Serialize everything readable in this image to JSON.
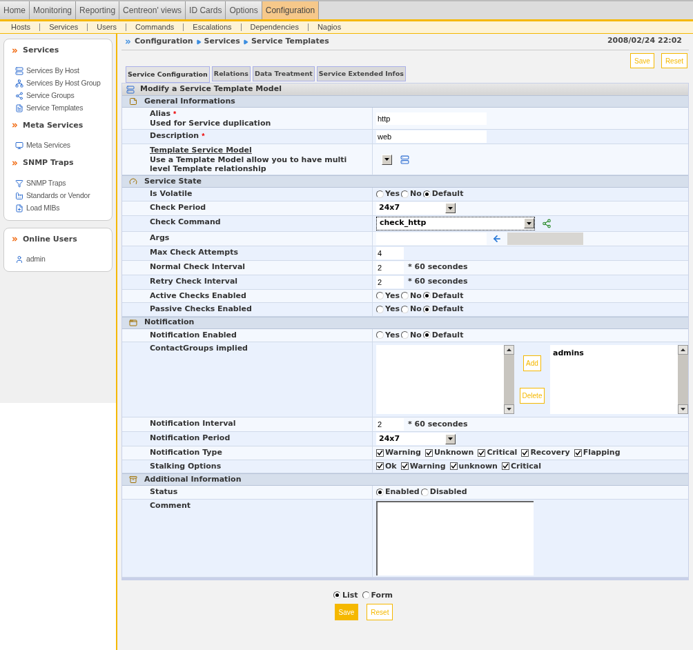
{
  "top_tabs": [
    {
      "label": "Home",
      "selected": false
    },
    {
      "label": "Monitoring",
      "selected": false
    },
    {
      "label": "Reporting",
      "selected": false
    },
    {
      "label": "Centreon' views",
      "selected": false
    },
    {
      "label": "ID Cards",
      "selected": false
    },
    {
      "label": "Options",
      "selected": false
    },
    {
      "label": "Configuration",
      "selected": true
    }
  ],
  "sub_nav": [
    "Hosts",
    "Services",
    "Users",
    "Commands",
    "Escalations",
    "Dependencies",
    "Nagios"
  ],
  "sidebar": {
    "panels": [
      {
        "sections": [
          {
            "title": "Services",
            "items": [
              "Services By Host",
              "Services By Host Group",
              "Service Groups",
              "Service Templates"
            ]
          },
          {
            "title": "Meta Services",
            "items": [
              "Meta Services"
            ]
          },
          {
            "title": "SNMP Traps",
            "items": [
              "SNMP Traps",
              "Standards or Vendor",
              "Load MIBs"
            ]
          }
        ]
      },
      {
        "sections": [
          {
            "title": "Online Users",
            "items": [
              "admin"
            ]
          }
        ]
      }
    ]
  },
  "breadcrumb": [
    "Configuration",
    "Services",
    "Service Templates"
  ],
  "datetime": "2008/02/24 22:02",
  "top_buttons": [
    "Save",
    "Reset"
  ],
  "form_tabs": [
    {
      "label": "Service Configuration",
      "selected": true
    },
    {
      "label": "Relations",
      "selected": false
    },
    {
      "label": "Data Treatment",
      "selected": false
    },
    {
      "label": "Service Extended Infos",
      "selected": false
    }
  ],
  "form": {
    "title": "Modify a Service Template Model",
    "sections": [
      {
        "title": "General Informations",
        "rows": [
          {
            "kind": "text",
            "label": "Alias",
            "required_mark": "*",
            "note": "Used for Service duplication",
            "value": "http"
          },
          {
            "kind": "text",
            "label": "Description",
            "required_mark": "*",
            "value": "web"
          },
          {
            "kind": "template",
            "label": "Template Service Model",
            "link": true,
            "note": "Use a Template Model allow you to have multi level Template relationship"
          }
        ]
      },
      {
        "title": "Service State",
        "rows": [
          {
            "kind": "radio",
            "label": "Is Volatile",
            "options": [
              {
                "label": "Yes",
                "selected": false
              },
              {
                "label": "No",
                "selected": false
              },
              {
                "label": "Default",
                "selected": true
              }
            ]
          },
          {
            "kind": "select",
            "label": "Check Period",
            "value": "24x7"
          },
          {
            "kind": "command",
            "label": "Check Command",
            "value": "check_http"
          },
          {
            "kind": "args",
            "label": "Args"
          },
          {
            "kind": "short",
            "label": "Max Check Attempts",
            "value": "4"
          },
          {
            "kind": "interval",
            "label": "Normal Check Interval",
            "value": "2",
            "unit": "* 60 secondes"
          },
          {
            "kind": "interval",
            "label": "Retry Check Interval",
            "value": "2",
            "unit": "* 60 secondes"
          },
          {
            "kind": "radio",
            "label": "Active Checks Enabled",
            "options": [
              {
                "label": "Yes",
                "selected": false
              },
              {
                "label": "No",
                "selected": false
              },
              {
                "label": "Default",
                "selected": true
              }
            ]
          },
          {
            "kind": "radio",
            "label": "Passive Checks Enabled",
            "options": [
              {
                "label": "Yes",
                "selected": false
              },
              {
                "label": "No",
                "selected": false
              },
              {
                "label": "Default",
                "selected": true
              }
            ]
          }
        ]
      },
      {
        "title": "Notification",
        "rows": [
          {
            "kind": "radio",
            "label": "Notification Enabled",
            "options": [
              {
                "label": "Yes",
                "selected": false
              },
              {
                "label": "No",
                "selected": false
              },
              {
                "label": "Default",
                "selected": true
              }
            ]
          },
          {
            "kind": "multi",
            "label": "ContactGroups implied",
            "selected_items": [
              "admins"
            ],
            "buttons": [
              "Add",
              "Delete"
            ]
          },
          {
            "kind": "interval",
            "label": "Notification Interval",
            "value": "2",
            "unit": "* 60 secondes"
          },
          {
            "kind": "select",
            "label": "Notification Period",
            "value": "24x7"
          },
          {
            "kind": "checks",
            "label": "Notification Type",
            "options": [
              {
                "label": "Warning",
                "checked": true
              },
              {
                "label": "Unknown",
                "checked": true
              },
              {
                "label": "Critical",
                "checked": true
              },
              {
                "label": "Recovery",
                "checked": true
              },
              {
                "label": "Flapping",
                "checked": true
              }
            ]
          },
          {
            "kind": "checks",
            "label": "Stalking Options",
            "options": [
              {
                "label": "Ok",
                "checked": true
              },
              {
                "label": "Warning",
                "checked": true
              },
              {
                "label": "unknown",
                "checked": true
              },
              {
                "label": "Critical",
                "checked": true
              }
            ]
          }
        ]
      },
      {
        "title": "Additional Information",
        "rows": [
          {
            "kind": "radio",
            "label": "Status",
            "options": [
              {
                "label": "Enabled",
                "selected": true
              },
              {
                "label": "Disabled",
                "selected": false
              }
            ]
          },
          {
            "kind": "textarea",
            "label": "Comment"
          }
        ]
      }
    ]
  },
  "view_options": [
    {
      "label": "List",
      "selected": true
    },
    {
      "label": "Form",
      "selected": false
    }
  ],
  "bottom_buttons": [
    {
      "label": "Save",
      "highlighted": true
    },
    {
      "label": "Reset",
      "highlighted": false
    }
  ]
}
